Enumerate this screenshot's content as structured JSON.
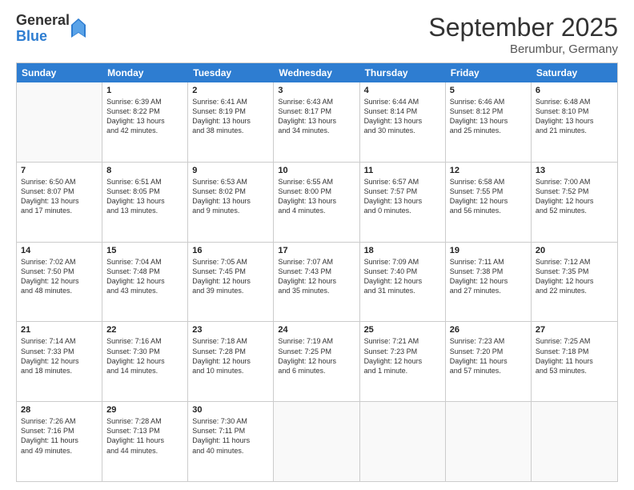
{
  "header": {
    "logo_general": "General",
    "logo_blue": "Blue",
    "title": "September 2025",
    "location": "Berumbur, Germany"
  },
  "days": [
    "Sunday",
    "Monday",
    "Tuesday",
    "Wednesday",
    "Thursday",
    "Friday",
    "Saturday"
  ],
  "rows": [
    [
      {
        "day": "",
        "lines": []
      },
      {
        "day": "1",
        "lines": [
          "Sunrise: 6:39 AM",
          "Sunset: 8:22 PM",
          "Daylight: 13 hours",
          "and 42 minutes."
        ]
      },
      {
        "day": "2",
        "lines": [
          "Sunrise: 6:41 AM",
          "Sunset: 8:19 PM",
          "Daylight: 13 hours",
          "and 38 minutes."
        ]
      },
      {
        "day": "3",
        "lines": [
          "Sunrise: 6:43 AM",
          "Sunset: 8:17 PM",
          "Daylight: 13 hours",
          "and 34 minutes."
        ]
      },
      {
        "day": "4",
        "lines": [
          "Sunrise: 6:44 AM",
          "Sunset: 8:14 PM",
          "Daylight: 13 hours",
          "and 30 minutes."
        ]
      },
      {
        "day": "5",
        "lines": [
          "Sunrise: 6:46 AM",
          "Sunset: 8:12 PM",
          "Daylight: 13 hours",
          "and 25 minutes."
        ]
      },
      {
        "day": "6",
        "lines": [
          "Sunrise: 6:48 AM",
          "Sunset: 8:10 PM",
          "Daylight: 13 hours",
          "and 21 minutes."
        ]
      }
    ],
    [
      {
        "day": "7",
        "lines": [
          "Sunrise: 6:50 AM",
          "Sunset: 8:07 PM",
          "Daylight: 13 hours",
          "and 17 minutes."
        ]
      },
      {
        "day": "8",
        "lines": [
          "Sunrise: 6:51 AM",
          "Sunset: 8:05 PM",
          "Daylight: 13 hours",
          "and 13 minutes."
        ]
      },
      {
        "day": "9",
        "lines": [
          "Sunrise: 6:53 AM",
          "Sunset: 8:02 PM",
          "Daylight: 13 hours",
          "and 9 minutes."
        ]
      },
      {
        "day": "10",
        "lines": [
          "Sunrise: 6:55 AM",
          "Sunset: 8:00 PM",
          "Daylight: 13 hours",
          "and 4 minutes."
        ]
      },
      {
        "day": "11",
        "lines": [
          "Sunrise: 6:57 AM",
          "Sunset: 7:57 PM",
          "Daylight: 13 hours",
          "and 0 minutes."
        ]
      },
      {
        "day": "12",
        "lines": [
          "Sunrise: 6:58 AM",
          "Sunset: 7:55 PM",
          "Daylight: 12 hours",
          "and 56 minutes."
        ]
      },
      {
        "day": "13",
        "lines": [
          "Sunrise: 7:00 AM",
          "Sunset: 7:52 PM",
          "Daylight: 12 hours",
          "and 52 minutes."
        ]
      }
    ],
    [
      {
        "day": "14",
        "lines": [
          "Sunrise: 7:02 AM",
          "Sunset: 7:50 PM",
          "Daylight: 12 hours",
          "and 48 minutes."
        ]
      },
      {
        "day": "15",
        "lines": [
          "Sunrise: 7:04 AM",
          "Sunset: 7:48 PM",
          "Daylight: 12 hours",
          "and 43 minutes."
        ]
      },
      {
        "day": "16",
        "lines": [
          "Sunrise: 7:05 AM",
          "Sunset: 7:45 PM",
          "Daylight: 12 hours",
          "and 39 minutes."
        ]
      },
      {
        "day": "17",
        "lines": [
          "Sunrise: 7:07 AM",
          "Sunset: 7:43 PM",
          "Daylight: 12 hours",
          "and 35 minutes."
        ]
      },
      {
        "day": "18",
        "lines": [
          "Sunrise: 7:09 AM",
          "Sunset: 7:40 PM",
          "Daylight: 12 hours",
          "and 31 minutes."
        ]
      },
      {
        "day": "19",
        "lines": [
          "Sunrise: 7:11 AM",
          "Sunset: 7:38 PM",
          "Daylight: 12 hours",
          "and 27 minutes."
        ]
      },
      {
        "day": "20",
        "lines": [
          "Sunrise: 7:12 AM",
          "Sunset: 7:35 PM",
          "Daylight: 12 hours",
          "and 22 minutes."
        ]
      }
    ],
    [
      {
        "day": "21",
        "lines": [
          "Sunrise: 7:14 AM",
          "Sunset: 7:33 PM",
          "Daylight: 12 hours",
          "and 18 minutes."
        ]
      },
      {
        "day": "22",
        "lines": [
          "Sunrise: 7:16 AM",
          "Sunset: 7:30 PM",
          "Daylight: 12 hours",
          "and 14 minutes."
        ]
      },
      {
        "day": "23",
        "lines": [
          "Sunrise: 7:18 AM",
          "Sunset: 7:28 PM",
          "Daylight: 12 hours",
          "and 10 minutes."
        ]
      },
      {
        "day": "24",
        "lines": [
          "Sunrise: 7:19 AM",
          "Sunset: 7:25 PM",
          "Daylight: 12 hours",
          "and 6 minutes."
        ]
      },
      {
        "day": "25",
        "lines": [
          "Sunrise: 7:21 AM",
          "Sunset: 7:23 PM",
          "Daylight: 12 hours",
          "and 1 minute."
        ]
      },
      {
        "day": "26",
        "lines": [
          "Sunrise: 7:23 AM",
          "Sunset: 7:20 PM",
          "Daylight: 11 hours",
          "and 57 minutes."
        ]
      },
      {
        "day": "27",
        "lines": [
          "Sunrise: 7:25 AM",
          "Sunset: 7:18 PM",
          "Daylight: 11 hours",
          "and 53 minutes."
        ]
      }
    ],
    [
      {
        "day": "28",
        "lines": [
          "Sunrise: 7:26 AM",
          "Sunset: 7:16 PM",
          "Daylight: 11 hours",
          "and 49 minutes."
        ]
      },
      {
        "day": "29",
        "lines": [
          "Sunrise: 7:28 AM",
          "Sunset: 7:13 PM",
          "Daylight: 11 hours",
          "and 44 minutes."
        ]
      },
      {
        "day": "30",
        "lines": [
          "Sunrise: 7:30 AM",
          "Sunset: 7:11 PM",
          "Daylight: 11 hours",
          "and 40 minutes."
        ]
      },
      {
        "day": "",
        "lines": []
      },
      {
        "day": "",
        "lines": []
      },
      {
        "day": "",
        "lines": []
      },
      {
        "day": "",
        "lines": []
      }
    ]
  ]
}
